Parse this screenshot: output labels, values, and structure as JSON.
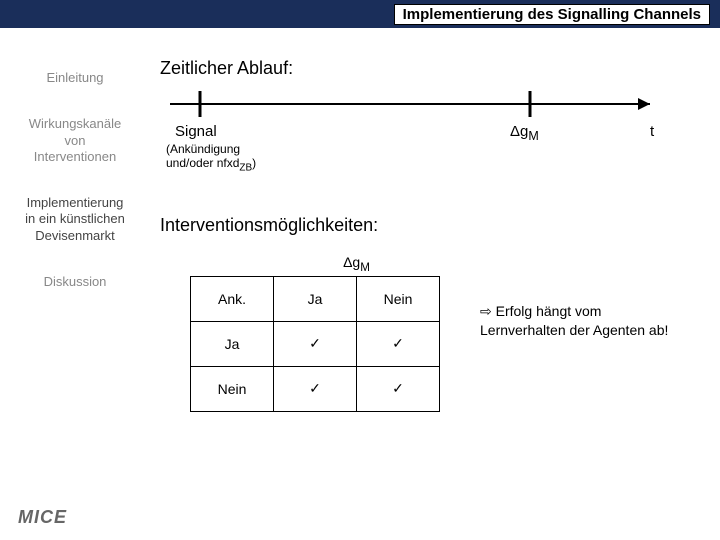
{
  "header": {
    "title": "Implementierung des Signalling Channels"
  },
  "sidebar": {
    "items": [
      {
        "label": "Einleitung"
      },
      {
        "label": "Wirkungskanäle\nvon\nInterventionen"
      },
      {
        "label": "Implementierung\nin ein künstlichen\nDevisenmarkt"
      },
      {
        "label": "Diskussion"
      }
    ]
  },
  "sections": {
    "timeline_title": "Zeitlicher Ablauf:",
    "signal_label": "Signal",
    "signal_sub1": "(Ankündigung",
    "signal_sub2_prefix": "und/oder nfxd",
    "signal_sub2_sub": "ZB",
    "signal_sub2_suffix": ")",
    "dgm_label_delta": "Δ",
    "dgm_label_g": "g",
    "dgm_label_m": "M",
    "t_label": "t",
    "intervention_title": "Interventionsmöglichkeiten:"
  },
  "matrix": {
    "top_header_delta": "Δ",
    "top_header_g": "g",
    "top_header_m": "M",
    "corner": "Ank.",
    "col1": "Ja",
    "col2": "Nein",
    "row1": "Ja",
    "row2": "Nein",
    "check": "✓"
  },
  "conclusion": {
    "arrow": "⇨",
    "text": "Erfolg hängt vom Lernverhalten der Agenten ab!"
  },
  "footer": {
    "logo": "MICE"
  }
}
